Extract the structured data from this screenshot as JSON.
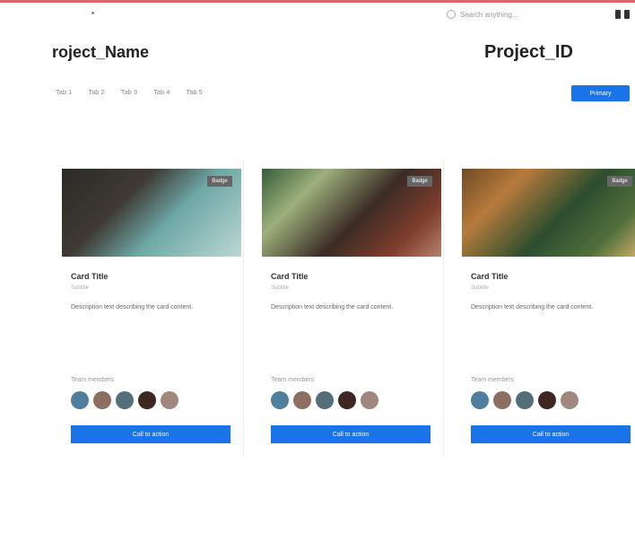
{
  "header": {
    "search_placeholder": "Search anything...",
    "title_left": "roject_Name",
    "title_right": "Project_ID",
    "tabs": [
      "Tab 1",
      "Tab 2",
      "Tab 3",
      "Tab 4",
      "Tab 5"
    ],
    "primary_button": "Primary"
  },
  "cards": [
    {
      "badge": "Badge",
      "title": "Card Title",
      "subtitle": "Subtitle",
      "description": "Description text describing the card content.",
      "team_label": "Team members",
      "avatars": [
        "avatar-1",
        "avatar-2",
        "avatar-3",
        "avatar-4",
        "avatar-5"
      ],
      "cta": "Call to action"
    },
    {
      "badge": "Badge",
      "title": "Card Title",
      "subtitle": "Subtitle",
      "description": "Description text describing the card content.",
      "team_label": "Team members",
      "avatars": [
        "avatar-1",
        "avatar-2",
        "avatar-3",
        "avatar-4",
        "avatar-5"
      ],
      "cta": "Call to action"
    },
    {
      "badge": "Badge",
      "title": "Card Title",
      "subtitle": "Subtitle",
      "description": "Description text describing the card content.",
      "team_label": "Team members",
      "avatars": [
        "avatar-1",
        "avatar-2",
        "avatar-3",
        "avatar-4",
        "avatar-5"
      ],
      "cta": "Call to action"
    }
  ],
  "colors": {
    "accent": "#1a73e8",
    "topbar": "#e0666b"
  }
}
